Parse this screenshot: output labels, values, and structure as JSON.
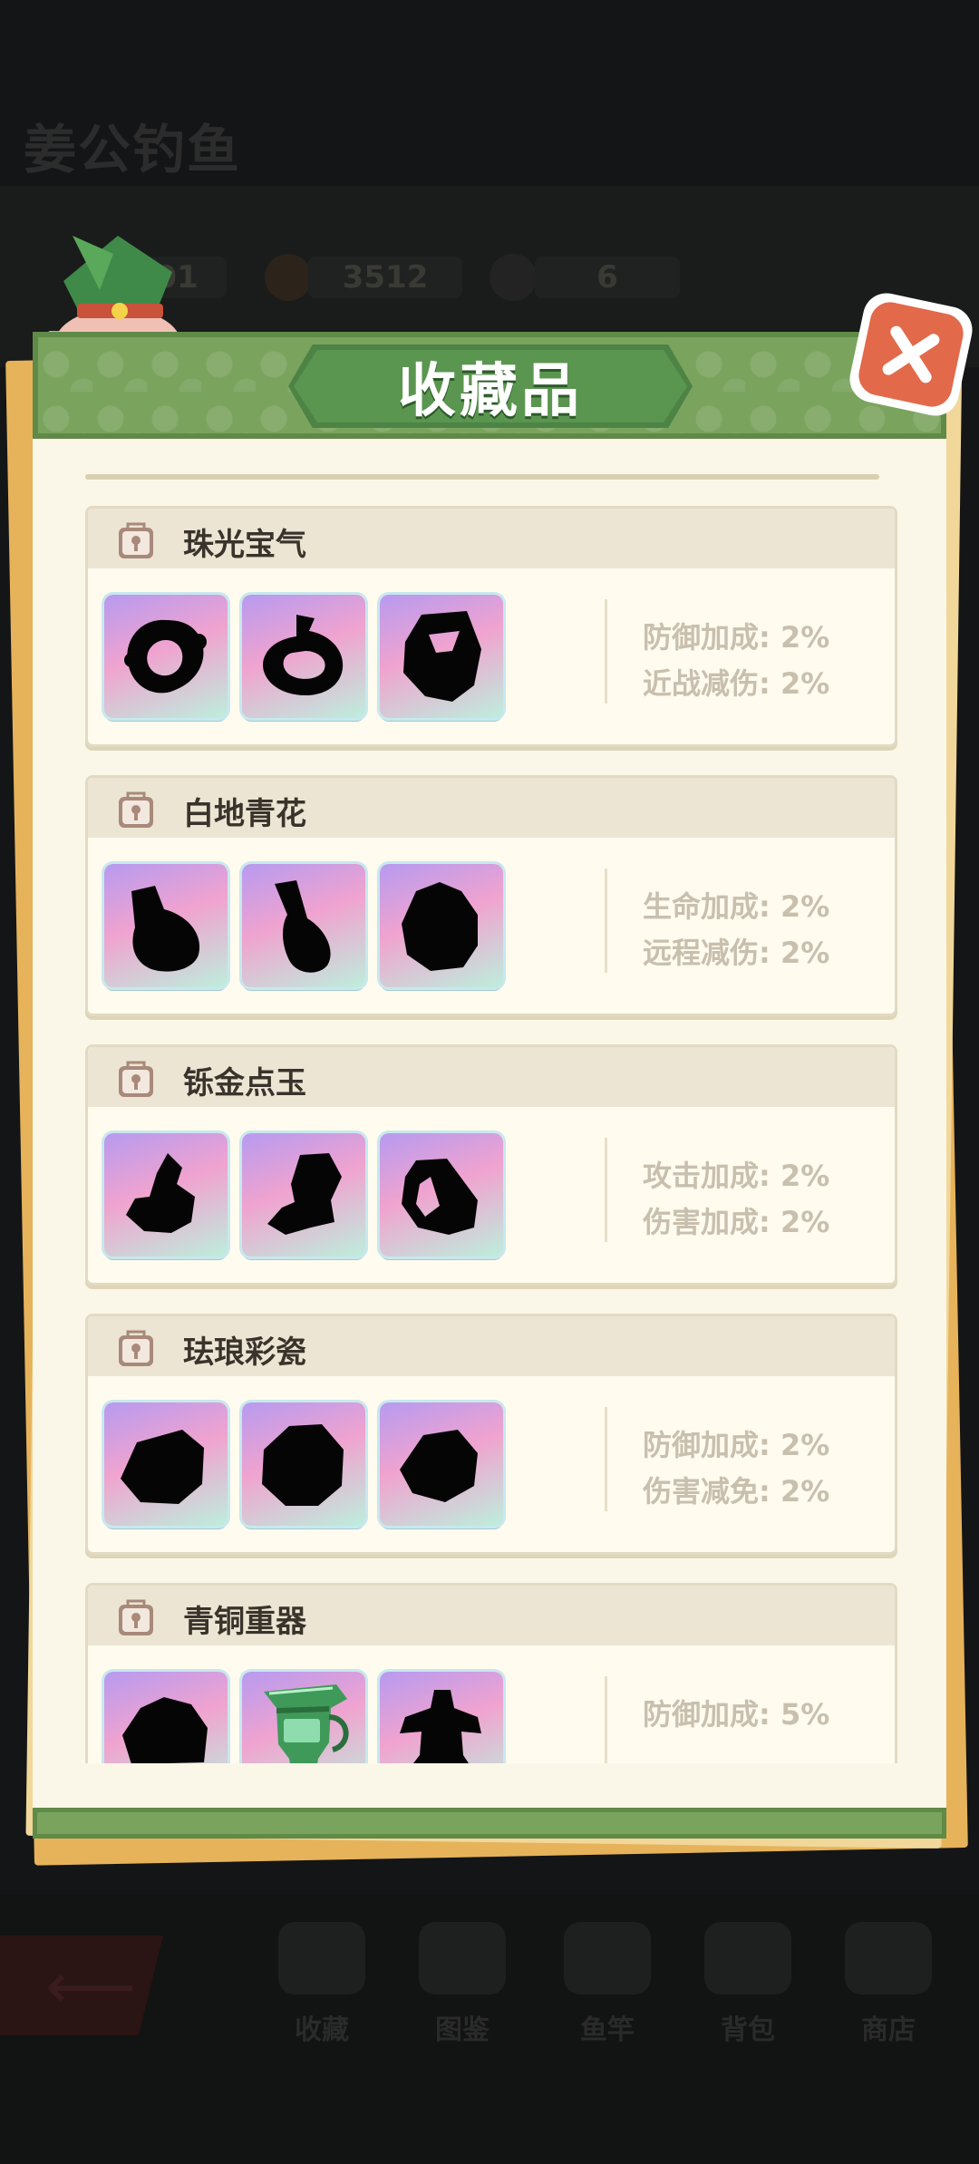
{
  "background": {
    "game_title": "姜公钓鱼",
    "stats": [
      "01",
      "3512",
      "6"
    ],
    "bottom_nav": [
      "收藏",
      "图鉴",
      "鱼竿",
      "背包",
      "商店"
    ]
  },
  "modal": {
    "title": "收藏品",
    "close_label": "✕"
  },
  "collections": [
    {
      "name": "珠光宝气",
      "items": [
        {
          "icon": "necklace-silhouette-icon",
          "unlocked": false
        },
        {
          "icon": "bracelet-silhouette-icon",
          "unlocked": false
        },
        {
          "icon": "pendant-silhouette-icon",
          "unlocked": false
        }
      ],
      "bonuses": [
        "防御加成: 2%",
        "近战减伤: 2%"
      ]
    },
    {
      "name": "白地青花",
      "items": [
        {
          "icon": "vase-silhouette-icon",
          "unlocked": false
        },
        {
          "icon": "bottle-silhouette-icon",
          "unlocked": false
        },
        {
          "icon": "jar-silhouette-icon",
          "unlocked": false
        }
      ],
      "bonuses": [
        "生命加成: 2%",
        "远程减伤: 2%"
      ]
    },
    {
      "name": "铄金点玉",
      "items": [
        {
          "icon": "jade-ornament-silhouette-icon",
          "unlocked": false
        },
        {
          "icon": "gold-beast-silhouette-icon",
          "unlocked": false
        },
        {
          "icon": "jade-ring-silhouette-icon",
          "unlocked": false
        }
      ],
      "bonuses": [
        "攻击加成: 2%",
        "伤害加成: 2%"
      ]
    },
    {
      "name": "珐琅彩瓷",
      "items": [
        {
          "icon": "enamel-dish-silhouette-icon",
          "unlocked": false
        },
        {
          "icon": "enamel-bowl-silhouette-icon",
          "unlocked": false
        },
        {
          "icon": "enamel-box-silhouette-icon",
          "unlocked": false
        }
      ],
      "bonuses": [
        "防御加成: 2%",
        "伤害减免: 2%"
      ]
    },
    {
      "name": "青铜重器",
      "items": [
        {
          "icon": "bronze-ding-silhouette-icon",
          "unlocked": false
        },
        {
          "icon": "bronze-jue-icon",
          "unlocked": true
        },
        {
          "icon": "bronze-figure-silhouette-icon",
          "unlocked": false
        }
      ],
      "bonuses": [
        "防御加成: 5%"
      ]
    }
  ],
  "colors": {
    "header_green": "#7aa45e",
    "plaque_green": "#5b9650",
    "close_red": "#e2694a",
    "panel_cream": "#fbf7e8",
    "bonus_text": "#c8bfae"
  }
}
